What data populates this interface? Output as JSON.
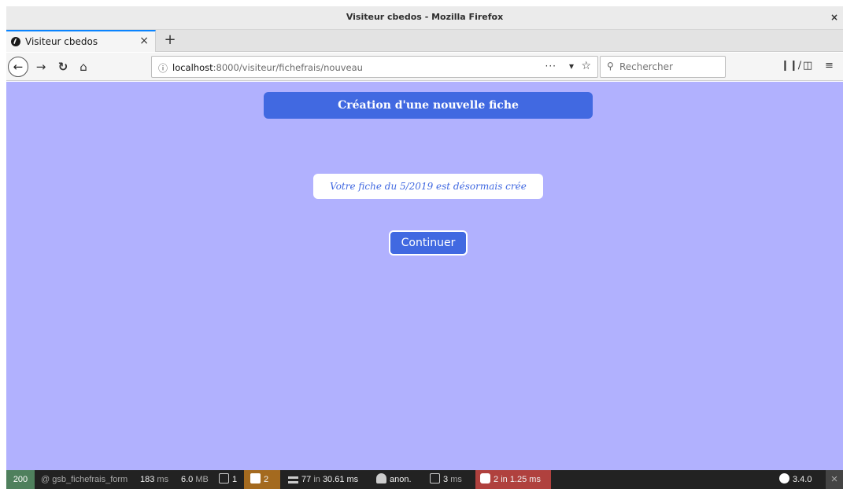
{
  "window": {
    "title": "Visiteur cbedos - Mozilla Firefox",
    "close_label": "×"
  },
  "tabs": [
    {
      "label": "Visiteur cbedos",
      "close_label": "×",
      "active": true
    }
  ],
  "new_tab_label": "+",
  "navbar": {
    "url_host": "localhost",
    "url_path": ":8000/visiteur/fichefrais/nouveau",
    "search_placeholder": "Rechercher",
    "more_label": "···"
  },
  "page": {
    "header": "Création d'une nouvelle fiche",
    "message": "Votre fiche du 5/2019 est désormais crée",
    "continue_label": "Continuer"
  },
  "debug_toolbar": {
    "status_code": "200",
    "route": "@ gsb_fichefrais_form",
    "time_value": "183",
    "time_unit": "ms",
    "memory_value": "6.0",
    "memory_unit": "MB",
    "forms_count": "1",
    "logs_count": "2",
    "cache_calls": "77",
    "cache_in": "in",
    "cache_time": "30.61 ms",
    "user": "anon.",
    "twig_time": "3",
    "twig_unit": "ms",
    "db_queries": "2",
    "db_in": "in",
    "db_time": "1.25 ms",
    "symfony_version": "3.4.0",
    "close_label": "×"
  },
  "colors": {
    "page_background": "#b1b1fe",
    "accent": "#4169e1",
    "status_ok": "#4f805d",
    "warning": "#a46a1f",
    "error": "#b0413e"
  }
}
